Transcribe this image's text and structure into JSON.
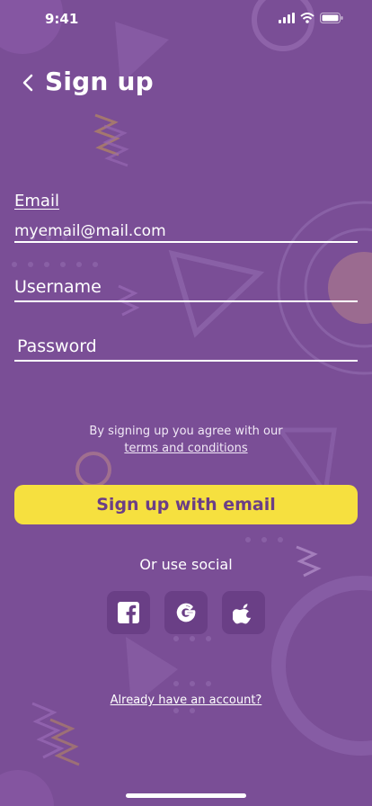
{
  "status_bar": {
    "time": "9:41"
  },
  "header": {
    "title": "Sign up"
  },
  "form": {
    "email_label": "Email",
    "email_value": "myemail@mail.com",
    "username_placeholder": "Username",
    "password_placeholder": "Password"
  },
  "agreement": {
    "line1": "By signing up you agree with our",
    "terms_link": "terms and conditions"
  },
  "cta": {
    "label": "Sign up with email"
  },
  "social": {
    "heading": "Or use social",
    "icons": [
      "facebook-icon",
      "google-icon",
      "apple-icon"
    ]
  },
  "footer": {
    "login_link": "Already have an account?"
  },
  "colors": {
    "background": "#7a4e96",
    "accent": "#f6e03f",
    "button_text": "#6b3e86",
    "social_button": "#6a3f86"
  }
}
